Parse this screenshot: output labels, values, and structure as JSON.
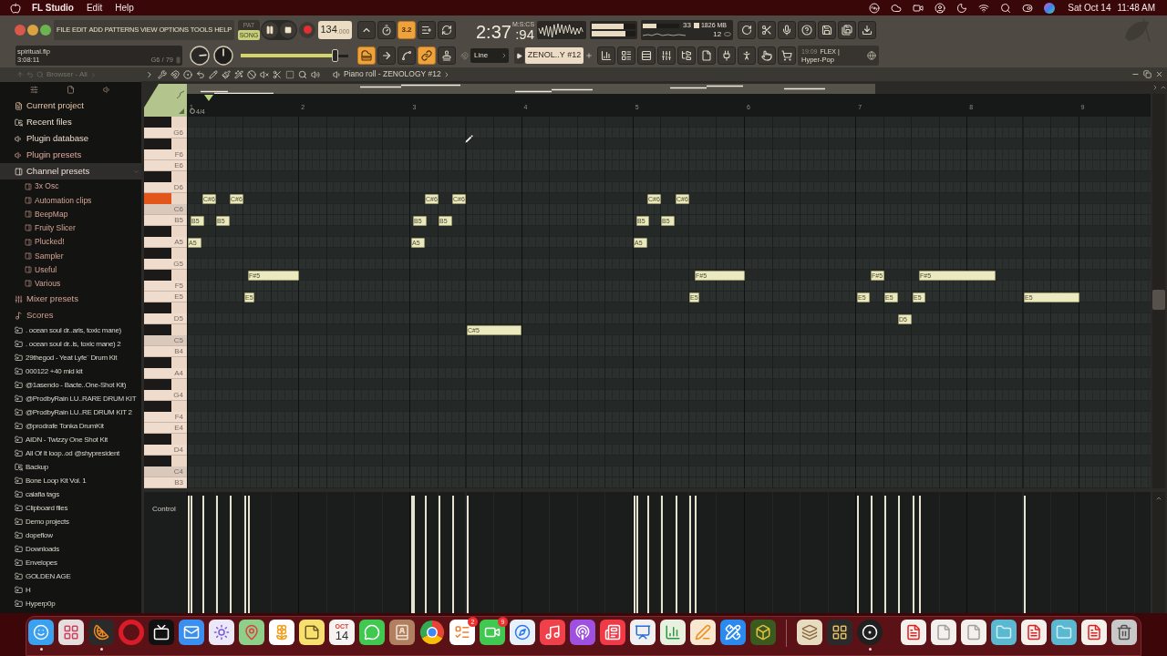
{
  "menubar": {
    "app": "FL Studio",
    "menus": [
      "Edit",
      "Help"
    ],
    "date": "Sat Oct 14",
    "time": "11:48 AM"
  },
  "toolbar": {
    "menus": [
      "FILE",
      "EDIT",
      "ADD",
      "PATTERNS",
      "VIEW",
      "OPTIONS",
      "TOOLS",
      "HELP"
    ],
    "modes": [
      {
        "label": "PAT",
        "selected": false
      },
      {
        "label": "SONG",
        "selected": true
      }
    ],
    "tempo": {
      "value": "134",
      "fraction": ".000"
    },
    "record_toggles": [
      {
        "on": false
      },
      {
        "on": false
      },
      {
        "on": true,
        "label": "3.2"
      },
      {
        "on": false
      },
      {
        "on": false
      }
    ],
    "time": {
      "main": "2:37",
      "sub": ":94",
      "unit": "M:S:CS"
    },
    "meters": [
      {
        "level": 0.72
      },
      {
        "level": 0.76
      }
    ],
    "cpu": {
      "value": "33",
      "level": 0.38
    },
    "memory": "1826 MB",
    "polyphony": "12",
    "hint": {
      "file": "spiritual.flp",
      "time": "3:08:11",
      "note": "G6 / 79"
    },
    "main_slider": {
      "level": 0.88
    },
    "tool_toggles": [
      {
        "on": true
      },
      {
        "on": false
      },
      {
        "on": false
      },
      {
        "on": true
      },
      {
        "on": false
      }
    ],
    "snap": "Line",
    "pattern": "ZENOL..Y #12",
    "news": {
      "time": "19:09",
      "tag": "FLEX |",
      "title": "Hyper-Pop"
    }
  },
  "browser": {
    "header": "Browser - All",
    "items": [
      {
        "label": "Current project",
        "kind": "project",
        "expanded": false,
        "selected": false
      },
      {
        "label": "Recent files",
        "kind": "recent",
        "expanded": false,
        "selected": false
      },
      {
        "label": "Plugin database",
        "kind": "plugins",
        "expanded": false,
        "selected": false
      },
      {
        "label": "Plugin presets",
        "kind": "presets",
        "expanded": false,
        "selected": false
      },
      {
        "label": "Channel presets",
        "kind": "channel",
        "expanded": true,
        "selected": true,
        "children": [
          {
            "label": "3x Osc",
            "selected": false
          },
          {
            "label": "Automation clips",
            "selected": false
          },
          {
            "label": "BeepMap",
            "selected": false
          },
          {
            "label": "Fruity Slicer",
            "selected": false
          },
          {
            "label": "Plucked!",
            "selected": false
          },
          {
            "label": "Sampler",
            "selected": false
          },
          {
            "label": "Useful",
            "selected": false
          },
          {
            "label": "Various",
            "selected": false
          }
        ]
      },
      {
        "label": "Mixer presets",
        "kind": "mixer",
        "expanded": false,
        "selected": false
      },
      {
        "label": "Scores",
        "kind": "scores",
        "expanded": false,
        "selected": false
      },
      {
        "label": ". ocean soul dr..aris, toxic mane)",
        "kind": "folder",
        "selected": false
      },
      {
        "label": ". ocean soul dr..is, toxic mane) 2",
        "kind": "folder",
        "selected": false
      },
      {
        "label": "29thegod - Yeat Lyfe¨ Drum Kit",
        "kind": "folder",
        "selected": false
      },
      {
        "label": "000122 +40 mid kit",
        "kind": "folder",
        "selected": false
      },
      {
        "label": "@1asendo - Bacte..One-Shot Kit)",
        "kind": "folder",
        "selected": false
      },
      {
        "label": "@ProdbyRain LU..RARE DRUM KIT",
        "kind": "folder",
        "selected": false
      },
      {
        "label": "@ProdbyRain LU..RE DRUM KIT 2",
        "kind": "folder",
        "selected": false
      },
      {
        "label": "@prodrafe Tonka DrumKit",
        "kind": "folder",
        "selected": false
      },
      {
        "label": "AIDN - Twizzy One Shot Kit",
        "kind": "folder",
        "selected": false
      },
      {
        "label": "All Of It loop..od @shypresident",
        "kind": "folder",
        "selected": false
      },
      {
        "label": "Backup",
        "kind": "backup",
        "selected": false
      },
      {
        "label": "Bone Loop Kit Vol. 1",
        "kind": "folder",
        "selected": false
      },
      {
        "label": "calafia tags",
        "kind": "folder",
        "selected": false
      },
      {
        "label": "Clipboard files",
        "kind": "folder",
        "selected": false
      },
      {
        "label": "Demo projects",
        "kind": "folder",
        "selected": false
      },
      {
        "label": "dopeflow",
        "kind": "folder",
        "selected": false
      },
      {
        "label": "Downloads",
        "kind": "folder",
        "selected": false
      },
      {
        "label": "Envelopes",
        "kind": "folder",
        "selected": false
      },
      {
        "label": "GOLDEN AGE",
        "kind": "folder",
        "selected": false
      },
      {
        "label": "H",
        "kind": "folder",
        "selected": false
      },
      {
        "label": "Hyperp0p",
        "kind": "folder",
        "selected": false
      }
    ]
  },
  "piano_roll": {
    "title": "Piano roll - ZENOLOGY #12",
    "bars": [
      "1",
      "2",
      "3",
      "4",
      "5",
      "6",
      "7",
      "8",
      "9"
    ],
    "time_signature": "4/4",
    "keys": [
      {
        "kind": "black",
        "pressed": false
      },
      {
        "kind": "white",
        "label": "G6",
        "pressed": false
      },
      {
        "kind": "black",
        "pressed": false
      },
      {
        "kind": "white",
        "label": "F6",
        "pressed": false
      },
      {
        "kind": "white",
        "label": "E6",
        "pressed": false
      },
      {
        "kind": "black",
        "pressed": false
      },
      {
        "kind": "white",
        "label": "D6",
        "pressed": false
      },
      {
        "kind": "black",
        "pressed": true
      },
      {
        "kind": "white",
        "label": "C6",
        "pressed": false
      },
      {
        "kind": "white",
        "label": "B5",
        "pressed": false
      },
      {
        "kind": "black",
        "pressed": false
      },
      {
        "kind": "white",
        "label": "A5",
        "pressed": false
      },
      {
        "kind": "black",
        "pressed": false
      },
      {
        "kind": "white",
        "label": "G5",
        "pressed": false
      },
      {
        "kind": "black",
        "pressed": false
      },
      {
        "kind": "white",
        "label": "F5",
        "pressed": false
      },
      {
        "kind": "white",
        "label": "E5",
        "pressed": false
      },
      {
        "kind": "black",
        "pressed": false
      },
      {
        "kind": "white",
        "label": "D5",
        "pressed": false
      },
      {
        "kind": "black",
        "pressed": false
      },
      {
        "kind": "white",
        "label": "C5",
        "pressed": false
      },
      {
        "kind": "white",
        "label": "B4",
        "pressed": false
      },
      {
        "kind": "black",
        "pressed": false
      },
      {
        "kind": "white",
        "label": "A4",
        "pressed": false
      },
      {
        "kind": "black",
        "pressed": false
      },
      {
        "kind": "white",
        "label": "G4",
        "pressed": false
      },
      {
        "kind": "black",
        "pressed": false
      },
      {
        "kind": "white",
        "label": "F4",
        "pressed": false
      },
      {
        "kind": "white",
        "label": "E4",
        "pressed": false
      },
      {
        "kind": "black",
        "pressed": false
      },
      {
        "kind": "white",
        "label": "D4",
        "pressed": false
      },
      {
        "kind": "black",
        "pressed": false
      },
      {
        "kind": "white",
        "label": "C4",
        "pressed": false
      },
      {
        "kind": "white",
        "label": "B3",
        "pressed": false
      }
    ],
    "notes": [
      {
        "label": "A5",
        "level": 0.97
      },
      {
        "label": "B5",
        "level": 0.97
      },
      {
        "label": "C#6",
        "level": 0.97
      },
      {
        "label": "B5",
        "level": 0.97
      },
      {
        "label": "C#6",
        "level": 0.97
      },
      {
        "label": "E5",
        "level": 0.97
      },
      {
        "label": "F#5",
        "level": 0.97
      },
      {
        "label": "A5",
        "level": 0.97
      },
      {
        "label": "B5",
        "level": 0.97
      },
      {
        "label": "C#6",
        "level": 0.97
      },
      {
        "label": "B5",
        "level": 0.97
      },
      {
        "label": "C#6",
        "level": 0.97
      },
      {
        "label": "C#5",
        "level": 0.97
      },
      {
        "label": "A5",
        "level": 0.97
      },
      {
        "label": "B5",
        "level": 0.97
      },
      {
        "label": "C#6",
        "level": 0.97
      },
      {
        "label": "B5",
        "level": 0.97
      },
      {
        "label": "C#6",
        "level": 0.97
      },
      {
        "label": "E5",
        "level": 0.97
      },
      {
        "label": "F#5",
        "level": 0.97
      },
      {
        "label": "E5",
        "level": 0.97
      },
      {
        "label": "F#5",
        "level": 0.97
      },
      {
        "label": "E5",
        "level": 0.97
      },
      {
        "label": "D5",
        "level": 0.97
      },
      {
        "label": "E5",
        "level": 0.97
      },
      {
        "label": "F#5",
        "level": 0.97
      },
      {
        "label": "E5",
        "level": 0.97
      }
    ],
    "lane_label": "Control"
  },
  "dock": [
    {
      "running": true
    },
    {
      "running": false
    },
    {
      "running": true
    },
    {
      "running": false
    },
    {
      "running": false
    },
    {
      "running": false
    },
    {
      "running": false
    },
    {
      "running": false
    },
    {
      "running": false
    },
    {
      "running": false
    },
    {
      "running": false,
      "month": "OCT",
      "day": "14"
    },
    {
      "running": false
    },
    {
      "running": false
    },
    {
      "running": false
    },
    {
      "running": false,
      "badge": "2"
    },
    {
      "running": false,
      "badge": "9"
    },
    {
      "running": false
    },
    {
      "running": false
    },
    {
      "running": false
    },
    {
      "running": false
    },
    {
      "running": false
    },
    {
      "running": false
    },
    {
      "running": false
    },
    {
      "running": false
    },
    {
      "running": false
    },
    {
      "running": false
    },
    {
      "running": false
    },
    {
      "running": true
    },
    {
      "running": false
    },
    {
      "running": false
    },
    {
      "running": false
    },
    {
      "running": false
    },
    {
      "running": false
    },
    {
      "running": false
    },
    {
      "running": false
    },
    {
      "running": false
    }
  ]
}
